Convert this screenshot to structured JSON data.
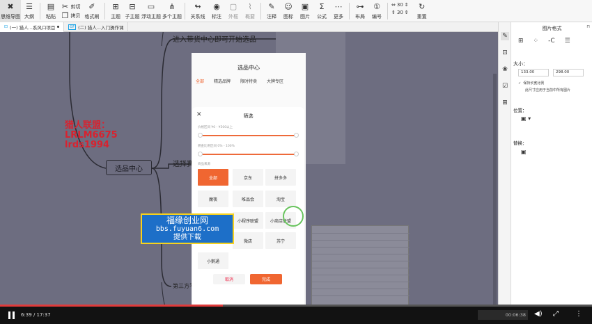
{
  "toolbar": {
    "items": [
      {
        "label": "思维导图",
        "icon": "mindmap-icon"
      },
      {
        "label": "大纲",
        "icon": "outline-icon"
      },
      {
        "label": "粘贴",
        "icon": "paste-icon"
      },
      {
        "label": "剪切",
        "icon": "cut-icon"
      },
      {
        "label": "拷贝",
        "icon": "copy-icon"
      },
      {
        "label": "格式刷",
        "icon": "format-brush-icon"
      },
      {
        "label": "主题",
        "icon": "topic-icon"
      },
      {
        "label": "子主题",
        "icon": "subtopic-icon"
      },
      {
        "label": "浮动主题",
        "icon": "floating-topic-icon"
      },
      {
        "label": "多个主题",
        "icon": "multi-topic-icon"
      },
      {
        "label": "关系线",
        "icon": "relation-line-icon"
      },
      {
        "label": "标注",
        "icon": "callout-icon"
      },
      {
        "label": "外框",
        "icon": "boundary-icon"
      },
      {
        "label": "概要",
        "icon": "summary-icon"
      },
      {
        "label": "注释",
        "icon": "note-icon"
      },
      {
        "label": "图标",
        "icon": "icons-icon"
      },
      {
        "label": "图片",
        "icon": "image-icon"
      },
      {
        "label": "公式",
        "icon": "formula-icon"
      },
      {
        "label": "更多",
        "icon": "more-icon"
      },
      {
        "label": "布局",
        "icon": "layout-icon"
      },
      {
        "label": "编号",
        "icon": "numbering-icon"
      }
    ],
    "spacing_h": "30",
    "spacing_v": "30",
    "reset_label": "重置"
  },
  "tabs": [
    {
      "badge": "",
      "label": "(一) 猎人...系风口项目",
      "active": true
    },
    {
      "badge": "GF",
      "label": "(二) 猎人...入门操作课",
      "active": false
    }
  ],
  "mindmap": {
    "central": "选品中心",
    "branches": [
      "进入带货中心即可开始选品",
      "选择赛",
      "第三方平"
    ],
    "note_lines": [
      "猎人联盟：",
      "LRLM6675",
      "lrds1994"
    ]
  },
  "phone": {
    "title": "选品中心",
    "tabs": [
      "全部",
      "精选品牌",
      "限时特卖",
      "大牌专区"
    ],
    "sheet": {
      "title": "筛选",
      "price_label": "价格区间 ¥0 - ¥500以上",
      "commission_label": "佣金比例区间 0% - 100%",
      "section_label": "商品来源",
      "chips": [
        "全部",
        "京东",
        "拼多多",
        "唯品会",
        "淘宝",
        "魔筷",
        "小程序联盟",
        "小商店联盟",
        "微店",
        "苏宁",
        "小鹅通"
      ],
      "cancel": "取消",
      "done": "完成"
    }
  },
  "watermark": {
    "line1": "福缘创业网",
    "line2": "bbs.fuyuan6.com",
    "line3": "提供下载"
  },
  "panel": {
    "title": "图片格式",
    "size_label": "大小：",
    "width": "133.00",
    "height": "298.00",
    "keep_ratio": "保持长宽比例",
    "apply_all": "此尺寸应用于当前中所有图片",
    "position_label": "位置：",
    "replace_label": "替换："
  },
  "video": {
    "time": "6:39 / 17:37",
    "progress": 0.377,
    "timestamp": "00:06:38"
  }
}
